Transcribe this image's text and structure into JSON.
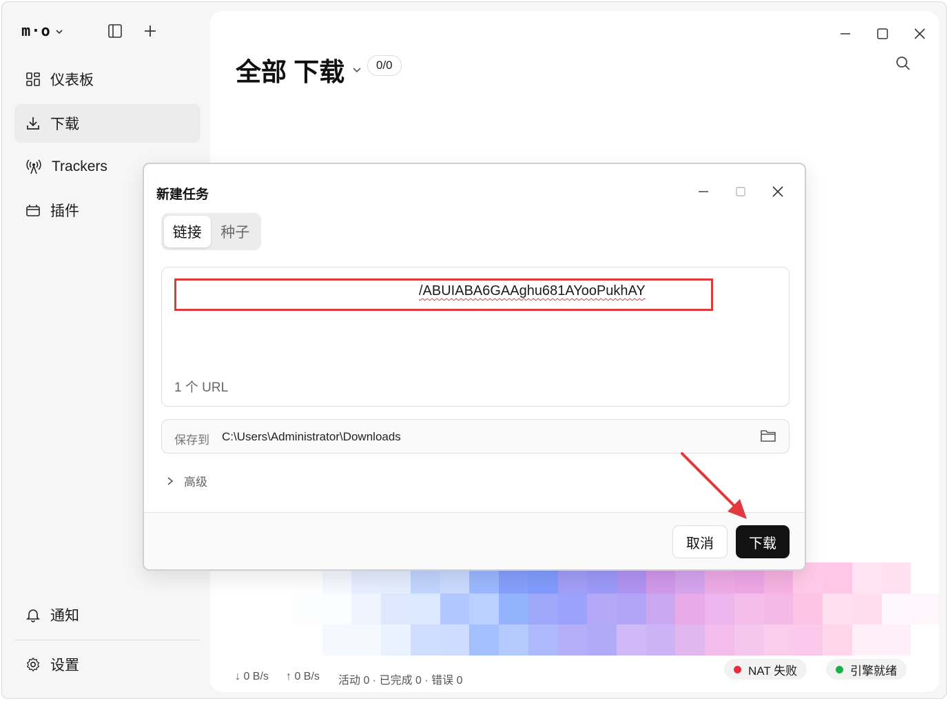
{
  "sidebar": {
    "logo": "m·o",
    "nav": [
      {
        "label": "仪表板",
        "icon": "dashboard-icon"
      },
      {
        "label": "下载",
        "icon": "download-icon",
        "active": true
      },
      {
        "label": "Trackers",
        "icon": "antenna-icon"
      },
      {
        "label": "插件",
        "icon": "plugin-icon"
      }
    ],
    "bottom": [
      {
        "label": "通知",
        "icon": "bell-icon"
      },
      {
        "label": "设置",
        "icon": "gear-icon"
      }
    ]
  },
  "main": {
    "title": "全部 下载",
    "count": "0/0"
  },
  "status": {
    "down_speed": "↓ 0 B/s",
    "up_speed": "↑ 0 B/s",
    "summary": "活动 0 · 已完成 0 · 错误 0",
    "nat": "NAT 失败",
    "engine": "引擎就绪",
    "colors": {
      "nat": "#e5303b",
      "engine": "#17b14a"
    }
  },
  "dialog": {
    "title": "新建任务",
    "tabs": [
      "链接",
      "种子"
    ],
    "active_tab": "链接",
    "url_value": "/ABUIABA6GAAghu681AYooPukhAY",
    "url_count": "1 个 URL",
    "save_label": "保存到",
    "save_path": "C:\\Users\\Administrator\\Downloads",
    "advanced_label": "高级",
    "cancel_label": "取消",
    "confirm_label": "下载"
  },
  "annotation_color": "#e0393e"
}
